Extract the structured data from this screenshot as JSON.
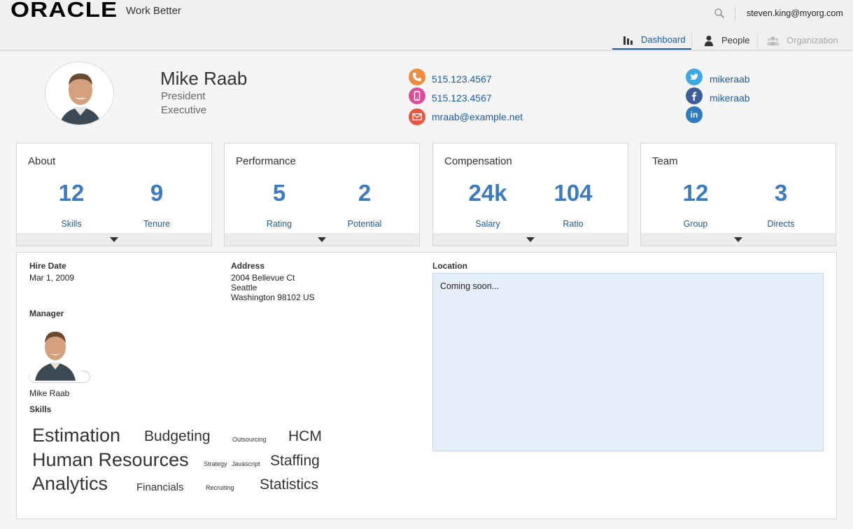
{
  "header": {
    "logo": "ORACLE",
    "tagline": "Work Better",
    "user_email": "steven.king@myorg.com",
    "search_icon": "search-icon"
  },
  "nav": {
    "tabs": [
      {
        "label": "Dashboard",
        "icon": "bar-chart-icon",
        "state": "active"
      },
      {
        "label": "People",
        "icon": "person-icon",
        "state": "normal"
      },
      {
        "label": "Organization",
        "icon": "group-icon",
        "state": "disabled"
      }
    ]
  },
  "profile": {
    "name": "Mike Raab",
    "title": "President",
    "level": "Executive",
    "phone_work": "515.123.4567",
    "phone_mobile": "515.123.4567",
    "email": "mraab@example.net",
    "twitter": "mikeraab",
    "facebook": "mikeraab",
    "linkedin_icon": "linkedin-icon"
  },
  "cards": [
    {
      "title": "About",
      "metrics": [
        {
          "value": "12",
          "label": "Skills"
        },
        {
          "value": "9",
          "label": "Tenure"
        }
      ]
    },
    {
      "title": "Performance",
      "metrics": [
        {
          "value": "5",
          "label": "Rating"
        },
        {
          "value": "2",
          "label": "Potential"
        }
      ]
    },
    {
      "title": "Compensation",
      "metrics": [
        {
          "value": "24k",
          "label": "Salary"
        },
        {
          "value": "104",
          "label": "Ratio"
        }
      ]
    },
    {
      "title": "Team",
      "metrics": [
        {
          "value": "12",
          "label": "Group"
        },
        {
          "value": "3",
          "label": "Directs"
        }
      ]
    }
  ],
  "details": {
    "hire_date_label": "Hire Date",
    "hire_date": "Mar 1, 2009",
    "address_label": "Address",
    "address_line1": "2004 Bellevue Ct",
    "address_line2": "Seattle",
    "address_line3": "Washington 98102 US",
    "location_label": "Location",
    "location_text": "Coming soon...",
    "manager_label": "Manager",
    "manager_name": "Mike Raab",
    "skills_label": "Skills",
    "skills": [
      "Estimation",
      "Budgeting",
      "Outsourcing",
      "HCM",
      "Human Resources",
      "Strategy",
      "Javascript",
      "Staffing",
      "Analytics",
      "Financials",
      "Recruiting",
      "Statistics"
    ]
  },
  "colors": {
    "accent": "#1a5da6",
    "metric": "#3c7bbf",
    "phone": "#f08a3c",
    "mobile": "#d94f9e",
    "email": "#e8573f",
    "twitter": "#3ea9e6",
    "facebook": "#3b5d9c",
    "linkedin": "#2f7bbf"
  }
}
